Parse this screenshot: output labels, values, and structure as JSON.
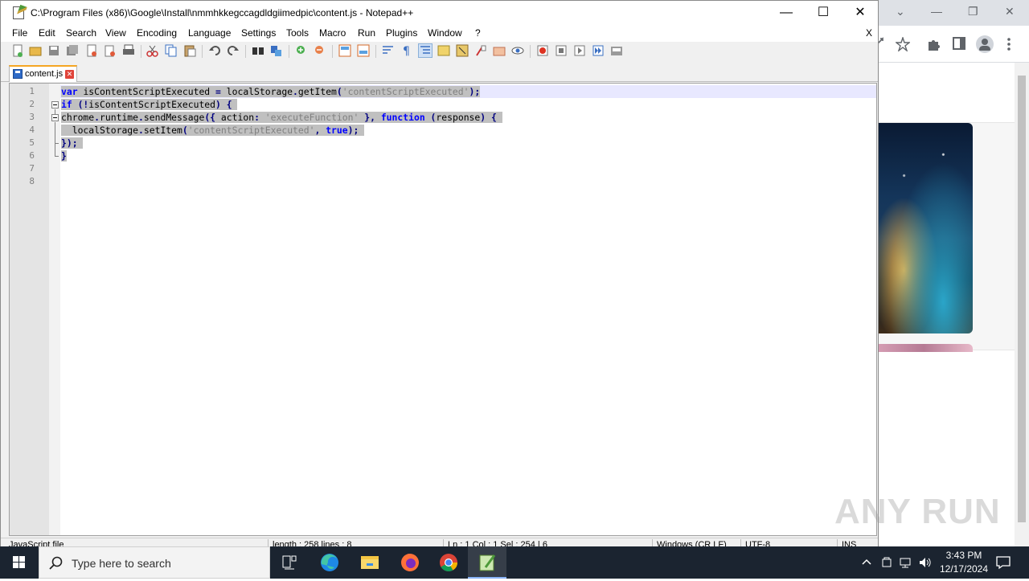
{
  "notepad": {
    "title": "C:\\Program Files (x86)\\Google\\Install\\nmmhkkegccagdldgiimedpic\\content.js - Notepad++",
    "window_controls": {
      "minimize": "—",
      "maximize": "☐",
      "close": "✕"
    },
    "menu": [
      "File",
      "Edit",
      "Search",
      "View",
      "Encoding",
      "Language",
      "Settings",
      "Tools",
      "Macro",
      "Run",
      "Plugins",
      "Window",
      "?"
    ],
    "menu_close": "X",
    "tab": {
      "label": "content.js",
      "close": "✕"
    },
    "line_numbers": [
      "1",
      "2",
      "3",
      "4",
      "5",
      "6",
      "7",
      "8"
    ],
    "code_lines": [
      "var isContentScriptExecuted = localStorage.getItem('contentScriptExecuted');",
      "if (!isContentScriptExecuted) {",
      "chrome.runtime.sendMessage({ action: 'executeFunction' }, function (response) {",
      "  localStorage.setItem('contentScriptExecuted', true);",
      "});",
      "}",
      "",
      ""
    ],
    "status": {
      "lang": "JavaScript file",
      "length": "length : 258    lines : 8",
      "position": "Ln : 1    Col : 1    Sel : 254 | 6",
      "eol": "Windows (CR LF)",
      "encoding": "UTF-8",
      "mode": "INS"
    }
  },
  "browser": {
    "controls": {
      "minimize": "—",
      "restore": "❐",
      "close": "✕",
      "dropdown": "⌄"
    },
    "toolbar_icons": [
      "share-icon",
      "star-icon",
      "extensions-icon",
      "sidepanel-icon",
      "profile-icon",
      "menu-icon"
    ]
  },
  "watermark": "ANY RUN",
  "taskbar": {
    "search_placeholder": "Type here to search",
    "time": "3:43 PM",
    "date": "12/17/2024"
  },
  "colors": {
    "keyword": "#0000ff",
    "string": "#808080",
    "selection": "#c0c0c0",
    "taskbar": "#1b2430"
  }
}
